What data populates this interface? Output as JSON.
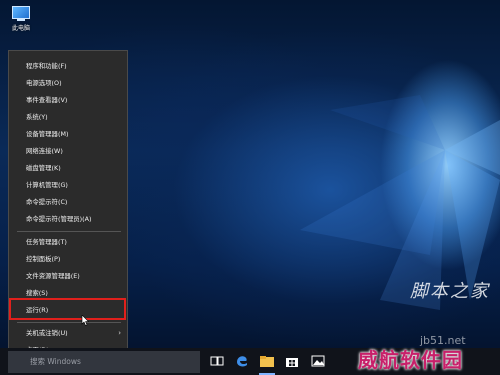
{
  "desktop": {
    "icon_label": "此电脑"
  },
  "menu": {
    "items": [
      {
        "label": "程序和功能(F)"
      },
      {
        "label": "电源选项(O)"
      },
      {
        "label": "事件查看器(V)"
      },
      {
        "label": "系统(Y)"
      },
      {
        "label": "设备管理器(M)"
      },
      {
        "label": "网络连接(W)"
      },
      {
        "label": "磁盘管理(K)"
      },
      {
        "label": "计算机管理(G)"
      },
      {
        "label": "命令提示符(C)"
      },
      {
        "label": "命令提示符(管理员)(A)"
      },
      {
        "label": "任务管理器(T)"
      },
      {
        "label": "控制面板(P)"
      },
      {
        "label": "文件资源管理器(E)"
      },
      {
        "label": "搜索(S)"
      },
      {
        "label": "运行(R)"
      },
      {
        "label": "关机或注销(U)"
      },
      {
        "label": "桌面(D)"
      }
    ],
    "highlighted_item": "运行(R)",
    "highlight_color": "#e0201c"
  },
  "taskbar": {
    "search_placeholder": "搜索 Windows",
    "icons": [
      "task-view-icon",
      "edge-icon",
      "file-explorer-icon",
      "store-icon",
      "photos-icon"
    ]
  },
  "watermark": {
    "line1": "脚本之家",
    "line2": "威航软件园",
    "line3": "jb51.net"
  }
}
